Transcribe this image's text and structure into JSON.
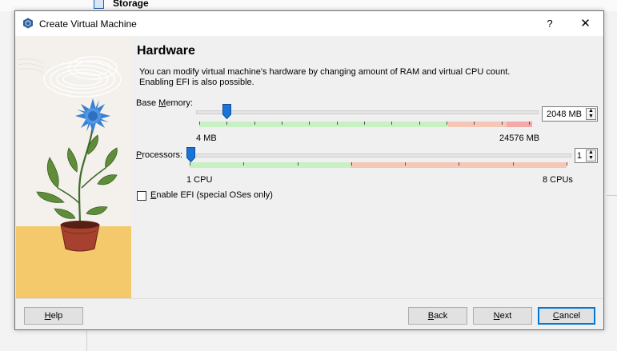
{
  "background": {
    "storage_label": "Storage"
  },
  "dialog": {
    "title": "Create Virtual Machine",
    "help_glyph": "?",
    "close_glyph": "✕",
    "heading": "Hardware",
    "description": "You can modify virtual machine's hardware by changing amount of RAM and virtual CPU count. Enabling EFI is also possible.",
    "memory": {
      "label_prefix": "Base ",
      "label_mnemonic": "M",
      "label_suffix": "emory:",
      "value": "2048 MB",
      "min_label": "4 MB",
      "max_label": "24576 MB",
      "current_mb": 2048,
      "min_mb": 4,
      "max_mb": 24576
    },
    "processors": {
      "label_mnemonic": "P",
      "label_suffix": "rocessors:",
      "value": "1",
      "min_label": "1 CPU",
      "max_label": "8 CPUs",
      "current": 1,
      "min": 1,
      "max": 8
    },
    "efi": {
      "label_mnemonic": "E",
      "label_suffix": "nable EFI (special OSes only)",
      "checked": false
    },
    "buttons": {
      "help": {
        "mnemonic": "H",
        "rest": "elp"
      },
      "back": {
        "mnemonic": "B",
        "rest": "ack"
      },
      "next": {
        "mnemonic": "N",
        "rest": "ext"
      },
      "cancel": {
        "mnemonic": "C",
        "rest": "ancel"
      }
    }
  },
  "colors": {
    "slider_ok": "#c7f0c3",
    "slider_warn": "#f5c7b6",
    "slider_bad": "#f3a9a7",
    "thumb": "#1a73d6",
    "default_button_border": "#0078d7"
  }
}
